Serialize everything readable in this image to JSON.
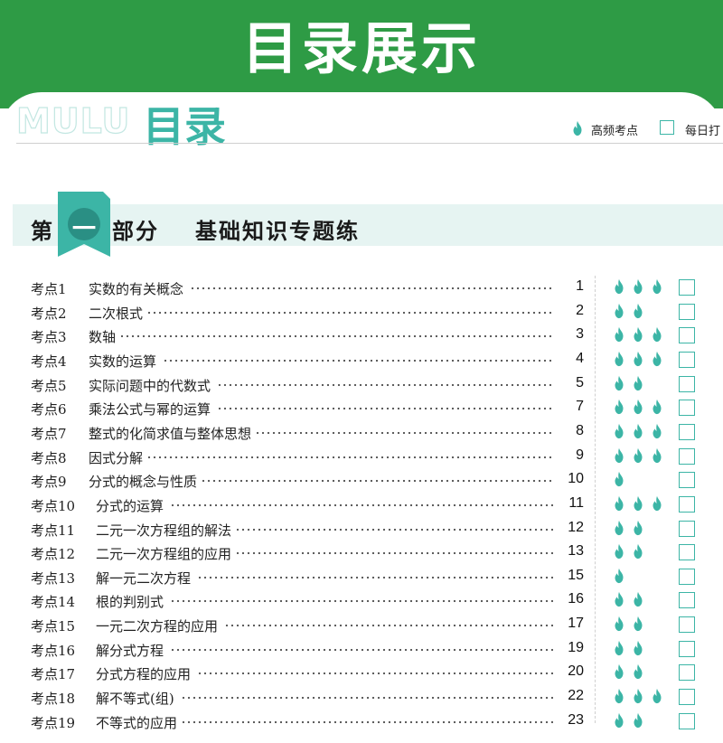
{
  "banner": {
    "title": "目录展示"
  },
  "header": {
    "mulu_en": "MULU",
    "mulu_zh": "目录"
  },
  "legend": {
    "frequent_label": "高频考点",
    "checkin_label": "每日打"
  },
  "part": {
    "prefix": "第",
    "number": "一",
    "suffix": "部分",
    "title": "基础知识专题练"
  },
  "colors": {
    "green": "#2e9b45",
    "teal": "#3cb5a6",
    "band": "#e6f4f2"
  },
  "toc": [
    {
      "code": "考点1",
      "title": "实数的有关概念",
      "page": "1",
      "flames": 3
    },
    {
      "code": "考点2",
      "title": "二次根式",
      "page": "2",
      "flames": 2
    },
    {
      "code": "考点3",
      "title": "数轴",
      "page": "3",
      "flames": 3
    },
    {
      "code": "考点4",
      "title": "实数的运算",
      "page": "4",
      "flames": 3
    },
    {
      "code": "考点5",
      "title": "实际问题中的代数式",
      "page": "5",
      "flames": 2
    },
    {
      "code": "考点6",
      "title": "乘法公式与幂的运算",
      "page": "7",
      "flames": 3
    },
    {
      "code": "考点7",
      "title": "整式的化简求值与整体思想",
      "page": "8",
      "flames": 3
    },
    {
      "code": "考点8",
      "title": "因式分解",
      "page": "9",
      "flames": 3
    },
    {
      "code": "考点9",
      "title": "分式的概念与性质",
      "page": "10",
      "flames": 1
    },
    {
      "code": "考点10",
      "title": "分式的运算",
      "page": "11",
      "flames": 3
    },
    {
      "code": "考点11",
      "title": "二元一次方程组的解法",
      "page": "12",
      "flames": 2
    },
    {
      "code": "考点12",
      "title": "二元一次方程组的应用",
      "page": "13",
      "flames": 2
    },
    {
      "code": "考点13",
      "title": "解一元二次方程",
      "page": "15",
      "flames": 1
    },
    {
      "code": "考点14",
      "title": "根的判别式",
      "page": "16",
      "flames": 2
    },
    {
      "code": "考点15",
      "title": "一元二次方程的应用",
      "page": "17",
      "flames": 2
    },
    {
      "code": "考点16",
      "title": "解分式方程",
      "page": "19",
      "flames": 2
    },
    {
      "code": "考点17",
      "title": "分式方程的应用",
      "page": "20",
      "flames": 2
    },
    {
      "code": "考点18",
      "title": "解不等式(组)",
      "page": "22",
      "flames": 3
    },
    {
      "code": "考点19",
      "title": "不等式的应用",
      "page": "23",
      "flames": 2
    }
  ]
}
